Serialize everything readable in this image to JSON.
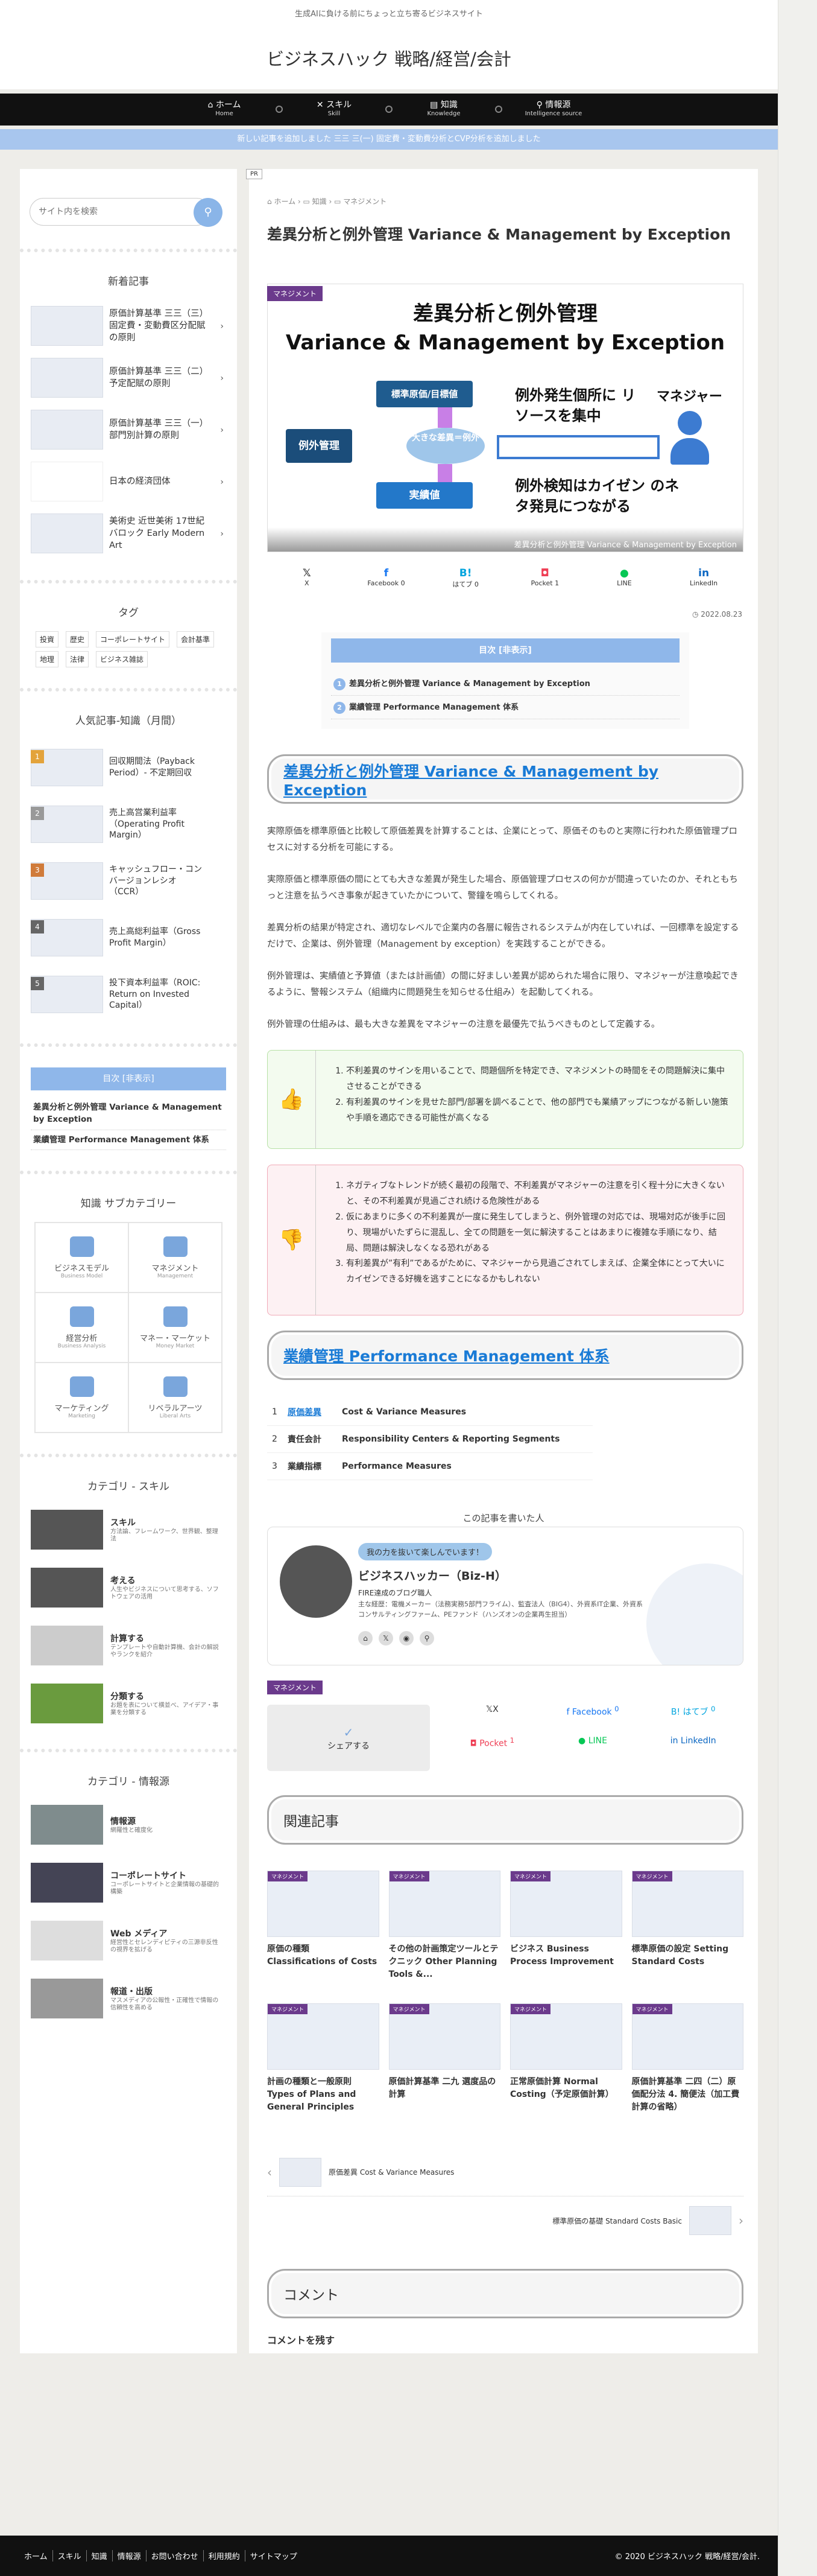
{
  "header": {
    "tagline": "生成AIに負ける前にちょっと立ち寄るビジネスサイト",
    "site_title": "ビジネスハック 戦略/経営/会計"
  },
  "nav": [
    {
      "label": "ホーム",
      "sub": "Home",
      "icon": "home-icon"
    },
    {
      "label": "スキル",
      "sub": "Skill",
      "icon": "tools-icon"
    },
    {
      "label": "知識",
      "sub": "Knowledge",
      "icon": "book-icon"
    },
    {
      "label": "情報源",
      "sub": "Intelligence source",
      "icon": "search-icon"
    }
  ],
  "notice": "新しい記事を追加しました 三三 三(一) 固定費・変動費分析とCVP分析を追加しました",
  "sidebar": {
    "search_placeholder": "サイト内を検索",
    "new_title": "新着記事",
    "new_posts": [
      "原価計算基準 三三（三）固定費・変動費区分配賦の原則",
      "原価計算基準 三三（二）予定配賦の原則",
      "原価計算基準 三三（一）部門別計算の原則",
      "日本の経済団体",
      "美術史 近世美術 17世紀 バロック Early Modern Art"
    ],
    "tags_title": "タグ",
    "tags": [
      "投資",
      "歴史",
      "コーポレートサイト",
      "会計基準",
      "地理",
      "法律",
      "ビジネス雑誌"
    ],
    "popular_title": "人気記事-知識（月間）",
    "popular": [
      {
        "n": "1",
        "title": "回収期間法（Payback Period）- 不定期回収"
      },
      {
        "n": "2",
        "title": "売上高営業利益率（Operating Profit Margin）"
      },
      {
        "n": "3",
        "title": "キャッシュフロー・コンバージョンレシオ（CCR）"
      },
      {
        "n": "4",
        "title": "売上高総利益率（Gross Profit Margin）"
      },
      {
        "n": "5",
        "title": "投下資本利益率（ROIC: Return on Invested Capital）"
      }
    ],
    "toc_title": "目次 [非表示]",
    "toc_items": [
      "差異分析と例外管理 Variance & Management by Exception",
      "業績管理 Performance Management 体系"
    ],
    "knowledge_title": "知識 サブカテゴリー",
    "knowledge": [
      {
        "label": "ビジネスモデル",
        "sub": "Business Model"
      },
      {
        "label": "マネジメント",
        "sub": "Management"
      },
      {
        "label": "経営分析",
        "sub": "Business Analysis"
      },
      {
        "label": "マネー・マーケット",
        "sub": "Money Market"
      },
      {
        "label": "マーケティング",
        "sub": "Marketing"
      },
      {
        "label": "リベラルアーツ",
        "sub": "Liberal Arts"
      }
    ],
    "skill_title": "カテゴリ - スキル",
    "skills": [
      {
        "title": "スキル",
        "desc": "方法論、フレームワーク、世界観、整理法"
      },
      {
        "title": "考える",
        "desc": "人生やビジネスについて思考する、ソフトウェアの活用"
      },
      {
        "title": "計算する",
        "desc": "テンプレートや自動計算機、会計の解説やランクを紹介"
      },
      {
        "title": "分類する",
        "desc": "お題を表について横並べ、アイデア・事業を分類する"
      }
    ],
    "info_title": "カテゴリ - 情報源",
    "infos": [
      {
        "title": "情報源",
        "desc": "網羅性と確度化"
      },
      {
        "title": "コーポレートサイト",
        "desc": "コーポレートサイトと企業情報の基礎的構築"
      },
      {
        "title": "Web メディア",
        "desc": "経営性とセレンディピティの三源非反性の視界を拡げる"
      },
      {
        "title": "報道・出版",
        "desc": "マスメディアの公報性・正確性で情報の信頼性を高める"
      }
    ]
  },
  "main": {
    "pr": "PR",
    "breadcrumb": [
      "ホーム",
      "知識",
      "マネジメント"
    ],
    "title": "差異分析と例外管理 Variance & Management by Exception",
    "category": "マネジメント",
    "eyecatch": {
      "title1": "差異分析と例外管理",
      "title2": "Variance & Management by Exception",
      "b_std": "標準原価/目標値",
      "b_ex": "例外管理",
      "b_diff": "大きな差異＝例外",
      "b_act": "実績値",
      "t1": "例外発生個所に リソースを集中",
      "manager": "マネジャー",
      "t2": "例外検知はカイゼン のネタ発見につながる",
      "caption": "差異分析と例外管理 Variance & Management by Exception"
    },
    "share_top": [
      {
        "label": "X",
        "count": ""
      },
      {
        "label": "Facebook",
        "count": "0"
      },
      {
        "label": "はてブ",
        "count": "0"
      },
      {
        "label": "Pocket",
        "count": "1"
      },
      {
        "label": "LINE",
        "count": ""
      },
      {
        "label": "LinkedIn",
        "count": ""
      }
    ],
    "date": "2022.08.23",
    "toc_title": "目次 [非表示]",
    "toc": [
      "差異分析と例外管理 Variance & Management by Exception",
      "業績管理 Performance Management 体系"
    ],
    "h2a": "差異分析と例外管理 Variance & Management by Exception",
    "paras": [
      "実際原価を標準原価と比較して原価差異を計算することは、企業にとって、原価そのものと実際に行われた原価管理プロセスに対する分析を可能にする。",
      "実際原価と標準原価の間にとても大きな差異が発生した場合、原価管理プロセスの何かが間違っていたのか、それともちっと注意を払うべき事象が起きていたかについて、警鐘を鳴らしてくれる。",
      "差異分析の結果が特定され、適切なレベルで企業内の各層に報告されるシステムが内在していれば、一回標準を設定するだけで、企業は、例外管理（Management by exception）を実践することができる。",
      "例外管理は、実績値と予算値（または計画値）の間に好ましい差異が認められた場合に限り、マネジャーが注意喚起できるように、警報システム（組織内に問題発生を知らせる仕組み）を起動してくれる。",
      "例外管理の仕組みは、最も大きな差異をマネジャーの注意を最優先で払うべきものとして定義する。"
    ],
    "pros": [
      "不利差異のサインを用いることで、問題個所を特定でき、マネジメントの時間をその問題解決に集中させることができる",
      "有利差異のサインを見せた部門/部署を調べることで、他の部門でも業績アップにつながる新しい施策や手順を適応できる可能性が高くなる"
    ],
    "cons": [
      "ネガティブなトレンドが続く最初の段階で、不利差異がマネジャーの注意を引く程十分に大きくないと、その不利差異が見過ごされ続ける危険性がある",
      "仮にあまりに多くの不利差異が一度に発生してしまうと、例外管理の対応では、現場対応が後手に回り、現場がいたずらに混乱し、全ての問題を一気に解決することはあまりに複雑な手順になり、結局、問題は解決しなくなる恐れがある",
      "有利差異が”有利”であるがために、マネジャーから見過ごされてしまえば、企業全体にとって大いにカイゼンできる好機を逃すことになるかもしれない"
    ],
    "h2b": "業績管理 Performance Management 体系",
    "table": [
      {
        "n": "1",
        "jp": "原価差異",
        "en": "Cost & Variance Measures"
      },
      {
        "n": "2",
        "jp": "責任会計",
        "en": "Responsibility Centers & Reporting Segments"
      },
      {
        "n": "3",
        "jp": "業績指標",
        "en": "Performance Measures"
      }
    ],
    "author_heading": "この記事を書いた人",
    "author": {
      "badge": "我の力を抜いて楽しんでいます！",
      "name": "ビジネスハッカー（Biz-H）",
      "role": "FIRE達成のブログ職人",
      "desc": "主な経歴：電機メーカー（法務実務5部門フライム）、監査法人（BIG4）、外資系IT企業、外資系コンサルティングファーム、PEファンド（ハンズオンの企業再生担当）"
    },
    "tag": "マネジメント",
    "share2_label": "シェアする",
    "share_bottom": [
      {
        "label": "X",
        "count": ""
      },
      {
        "label": "Facebook",
        "count": "0"
      },
      {
        "label": "はてブ",
        "count": "0"
      },
      {
        "label": "Pocket",
        "count": "1"
      },
      {
        "label": "LINE",
        "count": ""
      },
      {
        "label": "LinkedIn",
        "count": ""
      }
    ],
    "related_title": "関連記事",
    "related": [
      {
        "title": "原価の種類 Classifications of Costs",
        "cat": "マネジメント"
      },
      {
        "title": "その他の計画策定ツールとテクニック Other Planning Tools &...",
        "cat": "マネジメント"
      },
      {
        "title": "ビジネス Business Process Improvement",
        "cat": "マネジメント"
      },
      {
        "title": "標準原価の設定 Setting Standard Costs",
        "cat": "マネジメント"
      },
      {
        "title": "計画の種類と一般原則 Types of Plans and General Principles",
        "cat": "マネジメント"
      },
      {
        "title": "原価計算基準 二九 選度品の計算",
        "cat": "マネジメント"
      },
      {
        "title": "正常原価計算 Normal Costing（予定原価計算）",
        "cat": "マネジメント"
      },
      {
        "title": "原価計算基準 二四（二）原価配分法 4. 簡便法（加工費計算の省略）",
        "cat": "マネジメント"
      }
    ],
    "prev": "原価差異 Cost & Variance Measures",
    "next": "標準原価の基礎 Standard Costs Basic",
    "comment_title": "コメント",
    "comment_sub": "コメントを残す"
  },
  "footer": {
    "links": [
      "ホーム",
      "スキル",
      "知識",
      "情報源",
      "お問い合わせ",
      "利用規約",
      "サイトマップ"
    ],
    "copyright": "© 2020 ビジネスハック 戦略/経営/会計."
  }
}
